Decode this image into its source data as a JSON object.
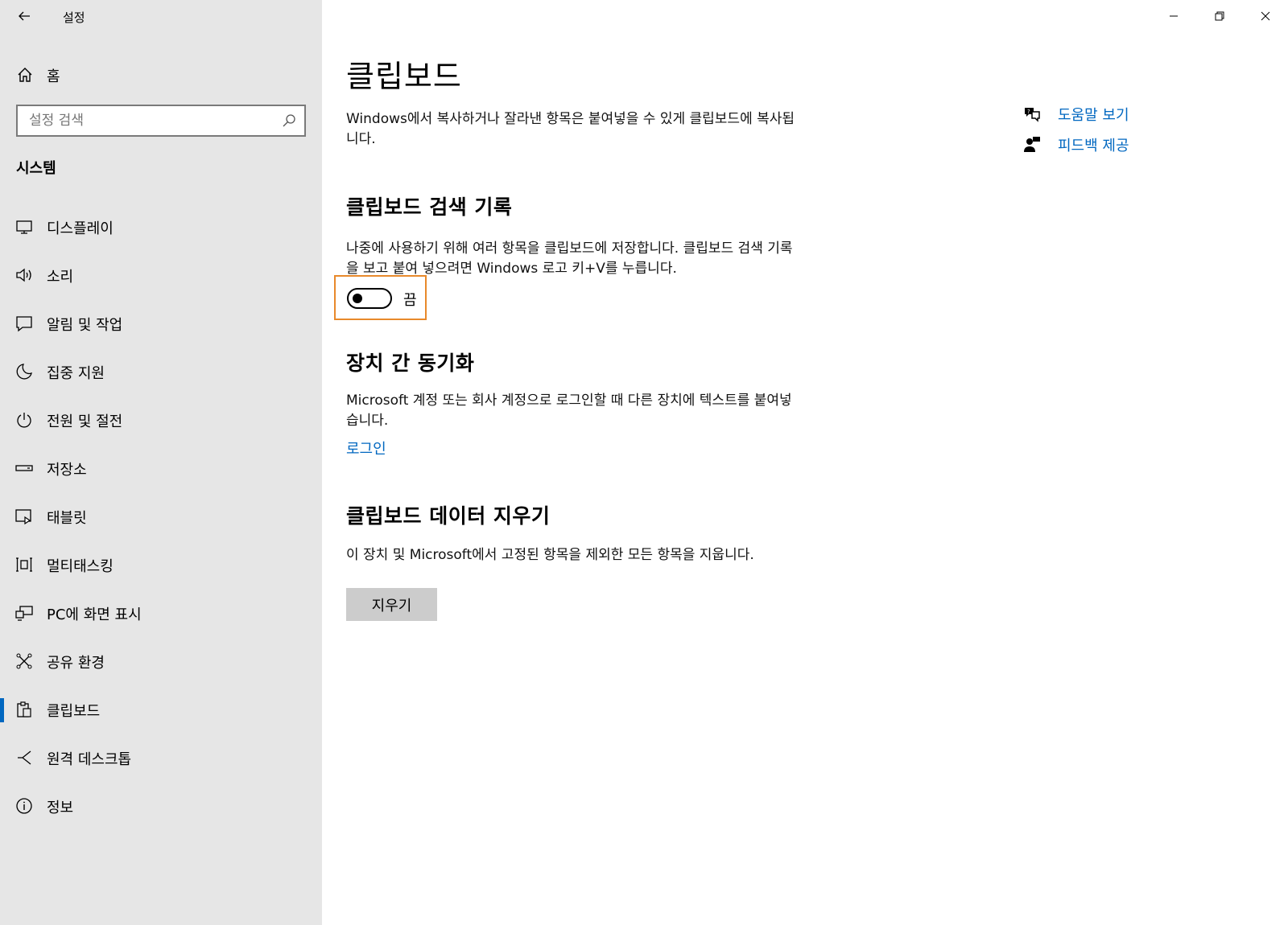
{
  "app": {
    "title": "설정"
  },
  "sidebar": {
    "home_label": "홈",
    "search_placeholder": "설정 검색",
    "section_label": "시스템",
    "items": [
      {
        "label": "디스플레이",
        "icon": "display-icon"
      },
      {
        "label": "소리",
        "icon": "speaker-icon"
      },
      {
        "label": "알림 및 작업",
        "icon": "notification-icon"
      },
      {
        "label": "집중 지원",
        "icon": "moon-icon"
      },
      {
        "label": "전원 및 절전",
        "icon": "power-icon"
      },
      {
        "label": "저장소",
        "icon": "storage-icon"
      },
      {
        "label": "태블릿",
        "icon": "tablet-icon"
      },
      {
        "label": "멀티태스킹",
        "icon": "multitasking-icon"
      },
      {
        "label": "PC에 화면 표시",
        "icon": "projecting-icon"
      },
      {
        "label": "공유 환경",
        "icon": "shared-experiences-icon"
      },
      {
        "label": "클립보드",
        "icon": "clipboard-icon",
        "active": true
      },
      {
        "label": "원격 데스크톱",
        "icon": "remote-desktop-icon"
      },
      {
        "label": "정보",
        "icon": "info-icon"
      }
    ]
  },
  "main": {
    "title": "클립보드",
    "intro": "Windows에서 복사하거나 잘라낸 항목은 붙여넣을 수 있게 클립보드에 복사됩니다.",
    "history": {
      "heading": "클립보드 검색 기록",
      "desc": "나중에 사용하기 위해 여러 항목을 클립보드에 저장합니다. 클립보드 검색 기록을 보고 붙여 넣으려면 Windows 로고 키+V를 누릅니다.",
      "toggle_label": "끔",
      "toggle_on": false
    },
    "sync": {
      "heading": "장치 간 동기화",
      "desc": "Microsoft 계정 또는 회사 계정으로 로그인할 때 다른 장치에 텍스트를 붙여넣습니다.",
      "link": "로그인"
    },
    "clear": {
      "heading": "클립보드 데이터 지우기",
      "desc": "이 장치 및 Microsoft에서 고정된 항목을 제외한 모든 항목을 지웁니다.",
      "button": "지우기"
    },
    "help": {
      "help_link": "도움말 보기",
      "feedback_link": "피드백 제공"
    }
  },
  "colors": {
    "accent": "#0067c0",
    "sidebar_bg": "#e6e6e6",
    "focus_outline": "#e8892b"
  }
}
